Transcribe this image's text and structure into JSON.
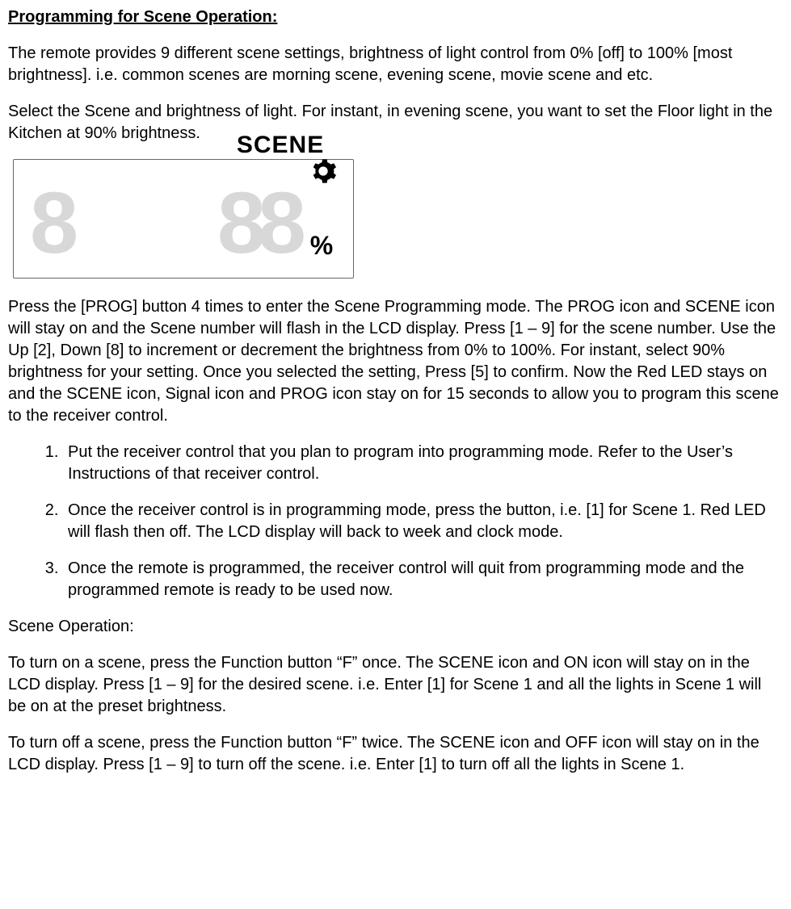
{
  "title": "Programming for Scene Operation:",
  "p1": "The remote provides 9 different scene settings, brightness of light control from 0% [off] to 100% [most brightness]. i.e. common scenes are morning scene, evening scene, movie scene and etc.",
  "p2": "Select the Scene and brightness of light. For instant, in evening scene, you want to set the Floor light in the Kitchen at 90% brightness.",
  "lcd": {
    "left_digit": "8",
    "scene_label": "SCENE",
    "right_digits": "88",
    "percent": "%"
  },
  "p3": "Press the [PROG] button 4 times to enter the Scene Programming mode. The PROG icon and SCENE icon will stay on and the Scene number will flash in the LCD display. Press [1 – 9] for the scene number. Use the Up [2], Down [8] to increment or decrement the brightness from 0% to 100%. For instant, select 90% brightness for your setting. Once you selected the setting, Press [5] to confirm. Now the Red LED stays on and the SCENE icon, Signal icon and PROG icon stay on for 15 seconds to allow you to program this scene to the receiver control.",
  "steps": [
    "Put the receiver control that you plan to program into programming mode. Refer to the User’s Instructions of that receiver control.",
    "Once the receiver control is in programming mode, press the button, i.e. [1] for Scene 1. Red LED will flash then off. The LCD display will back to week and clock mode.",
    " Once the remote is programmed, the receiver control will quit from programming mode and the programmed remote is ready to be used now."
  ],
  "subhead": "Scene Operation:",
  "p4": "To turn on a scene, press the Function button “F” once. The SCENE icon and ON icon will stay on in the LCD display. Press [1 – 9] for the desired scene. i.e. Enter [1] for Scene 1 and all the lights in Scene 1 will be on at the preset brightness.",
  "p5": "To turn off a scene, press the Function button “F” twice. The SCENE icon and OFF icon will stay on in the LCD display. Press [1 – 9] to turn off the scene. i.e. Enter [1] to turn off all the lights in Scene 1."
}
